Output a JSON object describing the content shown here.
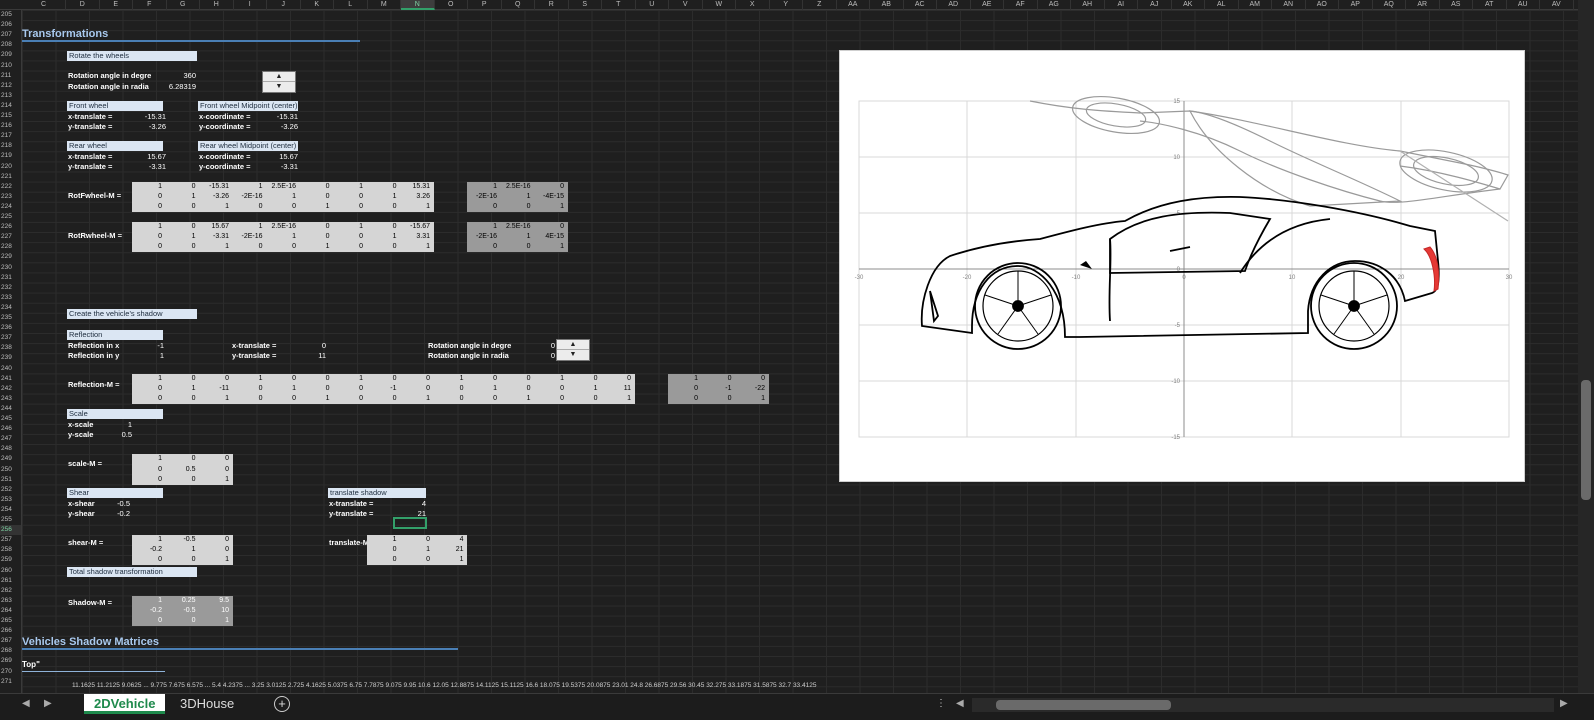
{
  "columns": [
    "C",
    "D",
    "E",
    "F",
    "G",
    "H",
    "I",
    "J",
    "K",
    "L",
    "M",
    "N",
    "O",
    "P",
    "Q",
    "R",
    "S",
    "T",
    "U",
    "V",
    "W",
    "X",
    "Y",
    "Z",
    "AA",
    "AB",
    "AC",
    "AD",
    "AE",
    "AF",
    "AG",
    "AH",
    "AI",
    "AJ",
    "AK",
    "AL",
    "AM",
    "AN",
    "AO",
    "AP",
    "AQ",
    "AR",
    "AS",
    "AT",
    "AU",
    "AV"
  ],
  "selected_column": "N",
  "selected_row": "256",
  "rows": [
    "205",
    "206",
    "207",
    "208",
    "209",
    "210",
    "211",
    "212",
    "213",
    "214",
    "215",
    "216",
    "217",
    "218",
    "219",
    "220",
    "221",
    "222",
    "223",
    "224",
    "225",
    "226",
    "227",
    "228",
    "229",
    "230",
    "231",
    "232",
    "233",
    "234",
    "235",
    "236",
    "237",
    "238",
    "239",
    "240",
    "241",
    "242",
    "243",
    "244",
    "245",
    "246",
    "247",
    "248",
    "249",
    "250",
    "251",
    "252",
    "253",
    "254",
    "255",
    "256",
    "257",
    "258",
    "259",
    "260",
    "261",
    "262",
    "263",
    "264",
    "265",
    "266",
    "267",
    "268",
    "269",
    "270",
    "271"
  ],
  "sheet": {
    "title_transformations": "Transformations",
    "rotate_wheels": "Rotate the wheels",
    "rot_deg_label": "Rotation angle in degre",
    "rot_deg_value": "360",
    "rot_rad_label": "Rotation angle in radia",
    "rot_rad_value": "6.28319",
    "front_wheel": "Front wheel",
    "fw_xt_label": "x-translate =",
    "fw_xt_value": "-15.31",
    "fw_yt_label": "y-translate =",
    "fw_yt_value": "-3.26",
    "fw_mid": "Front wheel Midpoint (center)",
    "fw_xc_label": "x-coordinate =",
    "fw_xc_value": "-15.31",
    "fw_yc_label": "y-coordinate =",
    "fw_yc_value": "-3.26",
    "rear_wheel": "Rear wheel",
    "rw_xt_label": "x-translate =",
    "rw_xt_value": "15.67",
    "rw_yt_label": "y-translate =",
    "rw_yt_value": "-3.31",
    "rw_mid": "Rear wheel Midpoint (center)",
    "rw_xc_label": "x-coordinate =",
    "rw_xc_value": "15.67",
    "rw_yc_label": "y-coordinate =",
    "rw_yc_value": "-3.31",
    "rotf_label": "RotFwheel-M =",
    "rotr_label": "RotRwheel-M =",
    "eq": "=",
    "create_shadow": "Create the vehicle's shadow",
    "reflection": "Reflection",
    "refl_x_label": "Reflection in x",
    "refl_x_value": "-1",
    "refl_y_label": "Reflection in y",
    "refl_y_value": "1",
    "sh_xt_label": "x-translate =",
    "sh_xt_value": "0",
    "sh_yt_label": "y-translate =",
    "sh_yt_value": "11",
    "sh_rot_deg_label": "Rotation angle in degre",
    "sh_rot_deg_value": "0",
    "sh_rot_rad_label": "Rotation angle in radia",
    "sh_rot_rad_value": "0",
    "refl_m_label": "Reflection-M =",
    "scale": "Scale",
    "xscale_label": "x-scale",
    "xscale_value": "1",
    "yscale_label": "y-scale",
    "yscale_value": "0.5",
    "scale_m_label": "scale-M =",
    "shear": "Shear",
    "xshear_label": "x-shear",
    "xshear_value": "-0.5",
    "yshear_label": "y-shear",
    "yshear_value": "-0.2",
    "shear_m_label": "shear-M =",
    "translate_shadow": "translate shadow",
    "ts_xt_label": "x-translate =",
    "ts_xt_value": "4",
    "ts_yt_label": "y-translate =",
    "ts_yt_value": "21",
    "translate_m_label": "translate-M =",
    "total_shadow": "Total shadow transformation",
    "shadow_m_label": "Shadow-M =",
    "title_vsm": "Vehicles Shadow Matrices",
    "top_label": "Top\""
  },
  "matrices": {
    "rotf_a": [
      [
        "1",
        "0",
        "-15.31"
      ],
      [
        "0",
        "1",
        "-3.26"
      ],
      [
        "0",
        "0",
        "1"
      ]
    ],
    "rotf_b": [
      [
        "1",
        "2.5E-16",
        "0"
      ],
      [
        "-2E-16",
        "1",
        "0"
      ],
      [
        "0",
        "0",
        "1"
      ]
    ],
    "rotf_c": [
      [
        "1",
        "0",
        "15.31"
      ],
      [
        "0",
        "1",
        "3.26"
      ],
      [
        "0",
        "0",
        "1"
      ]
    ],
    "rotf_r": [
      [
        "1",
        "2.5E-16",
        "0"
      ],
      [
        "-2E-16",
        "1",
        "-4E-15"
      ],
      [
        "0",
        "0",
        "1"
      ]
    ],
    "rotr_a": [
      [
        "1",
        "0",
        "15.67"
      ],
      [
        "0",
        "1",
        "-3.31"
      ],
      [
        "0",
        "0",
        "1"
      ]
    ],
    "rotr_b": [
      [
        "1",
        "2.5E-16",
        "0"
      ],
      [
        "-2E-16",
        "1",
        "0"
      ],
      [
        "0",
        "0",
        "1"
      ]
    ],
    "rotr_c": [
      [
        "1",
        "0",
        "-15.67"
      ],
      [
        "0",
        "1",
        "3.31"
      ],
      [
        "0",
        "0",
        "1"
      ]
    ],
    "rotr_r": [
      [
        "1",
        "2.5E-16",
        "0"
      ],
      [
        "-2E-16",
        "1",
        "4E-15"
      ],
      [
        "0",
        "0",
        "1"
      ]
    ],
    "refl_a": [
      [
        "1",
        "0",
        "0"
      ],
      [
        "0",
        "1",
        "-11"
      ],
      [
        "0",
        "0",
        "1"
      ]
    ],
    "refl_b": [
      [
        "1",
        "0",
        "0"
      ],
      [
        "0",
        "1",
        "0"
      ],
      [
        "0",
        "0",
        "1"
      ]
    ],
    "refl_c": [
      [
        "1",
        "0",
        "0"
      ],
      [
        "0",
        "-1",
        "0"
      ],
      [
        "0",
        "0",
        "1"
      ]
    ],
    "refl_d": [
      [
        "1",
        "0",
        "0"
      ],
      [
        "0",
        "1",
        "0"
      ],
      [
        "0",
        "0",
        "1"
      ]
    ],
    "refl_e": [
      [
        "1",
        "0",
        "0"
      ],
      [
        "0",
        "1",
        "11"
      ],
      [
        "0",
        "0",
        "1"
      ]
    ],
    "refl_r": [
      [
        "1",
        "0",
        "0"
      ],
      [
        "0",
        "-1",
        "-22"
      ],
      [
        "0",
        "0",
        "1"
      ]
    ],
    "scale_m": [
      [
        "1",
        "0",
        "0"
      ],
      [
        "0",
        "0.5",
        "0"
      ],
      [
        "0",
        "0",
        "1"
      ]
    ],
    "shear_m": [
      [
        "1",
        "-0.5",
        "0"
      ],
      [
        "-0.2",
        "1",
        "0"
      ],
      [
        "0",
        "0",
        "1"
      ]
    ],
    "translate_m": [
      [
        "1",
        "0",
        "4"
      ],
      [
        "0",
        "1",
        "21"
      ],
      [
        "0",
        "0",
        "1"
      ]
    ],
    "shadow_m": [
      [
        "1",
        "0.25",
        "9.5"
      ],
      [
        "-0.2",
        "-0.5",
        "10"
      ],
      [
        "0",
        "0",
        "1"
      ]
    ]
  },
  "bottom_row_values": "11.1625  11.2125  9.0625  ...  9.775  7.675  6.575  ...  5.4  4.2375  ...  3.25  3.0125  2.725  4.1625  5.0375  6.75  7.7875  9.075  9.95  10.6  12.05  12.8875  14.1125  15.1125  16.6  18.075  19.5375  20.0875  23.01  24.8  26.6875  29.56  30.45  32.275  33.1875  31.5875  32.7  33.4125",
  "chart": {
    "x_ticks": [
      "-30",
      "-20",
      "-10",
      "0",
      "10",
      "20",
      "30"
    ],
    "y_ticks": [
      "15",
      "10",
      "5",
      "0",
      "-5",
      "-10",
      "-15"
    ]
  },
  "tabs": {
    "prev": "◀",
    "next": "▶",
    "sheet1": "2DVehicle",
    "sheet2": "3DHouse",
    "add": "+"
  },
  "spin_up": "▲",
  "spin_down": "▼",
  "colors": {
    "accent": "#1e8a4c",
    "heading": "#a9c9ee"
  }
}
